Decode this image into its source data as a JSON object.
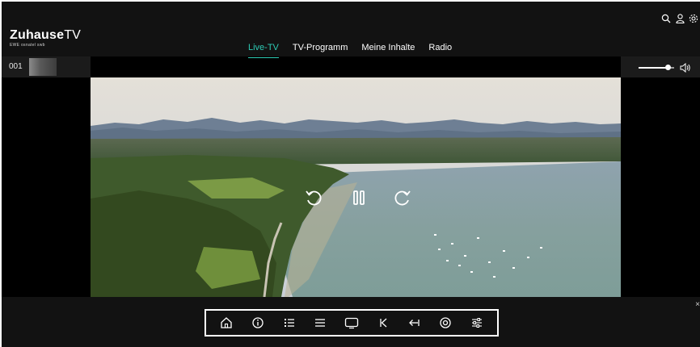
{
  "app": {
    "logo_main": "Zuhause",
    "logo_tv": "TV",
    "logo_partners": "EWE osnatel swb"
  },
  "nav": {
    "tabs": [
      {
        "label": "Live-TV",
        "active": true
      },
      {
        "label": "TV-Programm",
        "active": false
      },
      {
        "label": "Meine Inhalte",
        "active": false
      },
      {
        "label": "Radio",
        "active": false
      }
    ]
  },
  "top_icons": [
    "search-icon",
    "user-icon",
    "settings-icon"
  ],
  "channel": {
    "number": "001"
  },
  "volume": {
    "level": 0.82,
    "icon": "speaker-icon"
  },
  "player": {
    "controls": [
      "rewind-icon",
      "pause-icon",
      "forward-icon"
    ]
  },
  "toolbar": {
    "buttons": [
      "home-icon",
      "info-icon",
      "channel-list-icon",
      "menu-icon",
      "screen-icon",
      "skip-back-icon",
      "back-icon",
      "record-icon",
      "settings-sliders-icon"
    ]
  },
  "close_label": "×",
  "colors": {
    "accent": "#2ecbb5",
    "background": "#000000",
    "bar": "#121212"
  }
}
